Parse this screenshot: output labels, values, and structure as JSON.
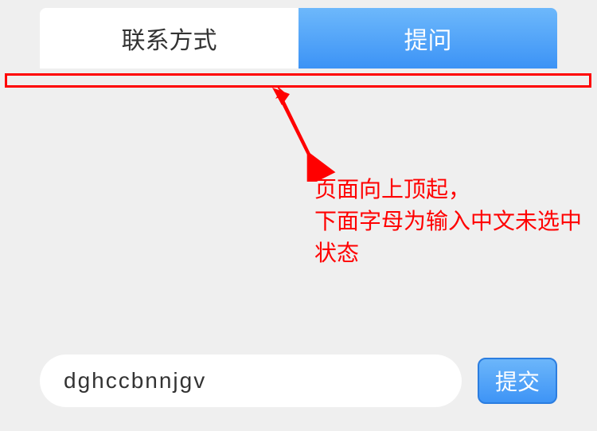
{
  "tabs": {
    "inactive_label": "联系方式",
    "active_label": "提问"
  },
  "annotation": {
    "line1": "页面向上顶起，",
    "line2": "下面字母为输入中文未选中",
    "line3": "状态"
  },
  "input": {
    "value": "dghccbnnjgv",
    "placeholder": ""
  },
  "submit": {
    "label": "提交"
  },
  "colors": {
    "annotation": "#ff0000",
    "tab_active_start": "#6db8fb",
    "tab_active_end": "#3c93f6",
    "background": "#efefef"
  }
}
